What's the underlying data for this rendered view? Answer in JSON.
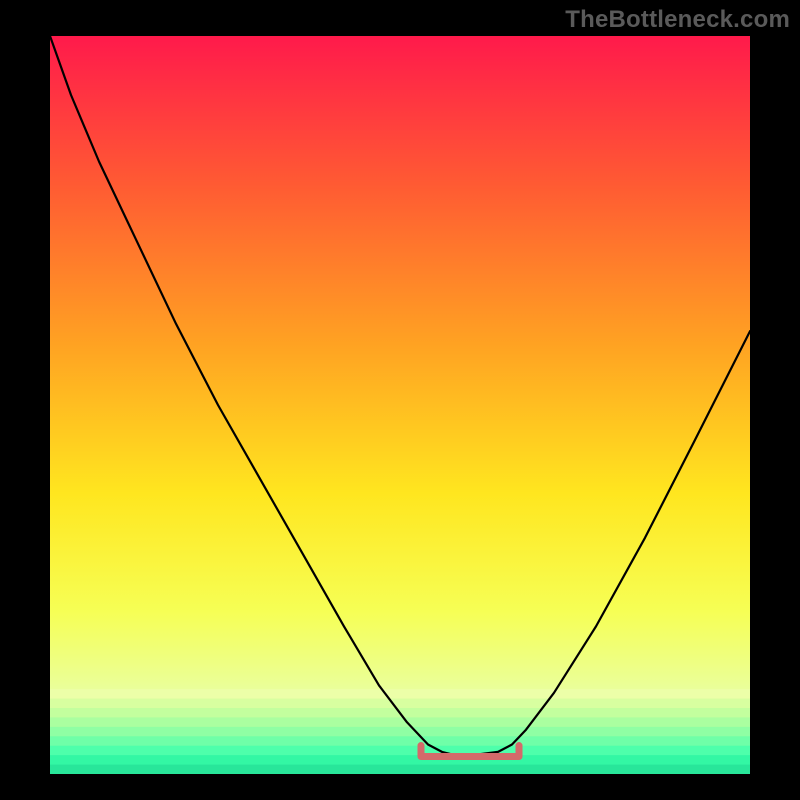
{
  "watermark": "TheBottleneck.com",
  "colors": {
    "frame": "#000000",
    "curve": "#000000",
    "marker": "#d46a6a",
    "gradient_stops": [
      {
        "offset": 0.0,
        "color": "#ff1a4b"
      },
      {
        "offset": 0.2,
        "color": "#ff5a33"
      },
      {
        "offset": 0.42,
        "color": "#ffa322"
      },
      {
        "offset": 0.62,
        "color": "#ffe61f"
      },
      {
        "offset": 0.78,
        "color": "#f6ff55"
      },
      {
        "offset": 0.885,
        "color": "#eaff9a"
      },
      {
        "offset": 0.93,
        "color": "#b8ffb0"
      },
      {
        "offset": 0.965,
        "color": "#4fffad"
      },
      {
        "offset": 1.0,
        "color": "#28e69a"
      }
    ],
    "bottom_stripes": [
      "#ecffa8",
      "#d8ffa0",
      "#c3ff9e",
      "#aaffa0",
      "#8fffa4",
      "#6fffa8",
      "#4effab",
      "#33f7a4",
      "#28e69a"
    ]
  },
  "chart_data": {
    "type": "line",
    "title": "",
    "xlabel": "",
    "ylabel": "",
    "xlim": [
      0,
      100
    ],
    "ylim": [
      0,
      100
    ],
    "series": [
      {
        "name": "bottleneck-curve",
        "x": [
          0,
          3,
          7,
          12,
          18,
          24,
          30,
          36,
          42,
          47,
          51,
          54,
          56,
          58,
          60,
          64,
          66,
          68,
          72,
          78,
          85,
          92,
          100
        ],
        "y": [
          100,
          92,
          83,
          73,
          61,
          50,
          40,
          30,
          20,
          12,
          7,
          4,
          3,
          2.5,
          2.5,
          3,
          4,
          6,
          11,
          20,
          32,
          45,
          60
        ]
      }
    ],
    "annotations": [
      {
        "name": "valley-bracket",
        "shape": "bracket",
        "x_range": [
          53,
          67
        ],
        "y": 2.5
      }
    ]
  }
}
